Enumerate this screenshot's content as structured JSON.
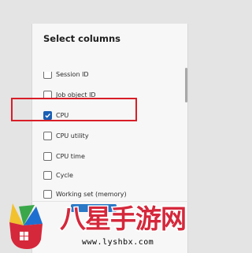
{
  "dialog": {
    "title": "Select columns",
    "columns": [
      {
        "label": "Session ID",
        "checked": false
      },
      {
        "label": "Job object ID",
        "checked": false
      },
      {
        "label": "CPU",
        "checked": true
      },
      {
        "label": "CPU utility",
        "checked": false,
        "highlighted": true
      },
      {
        "label": "CPU time",
        "checked": false
      },
      {
        "label": "Cycle",
        "checked": false
      },
      {
        "label": "Working set (memory)",
        "checked": false
      }
    ]
  },
  "watermark": {
    "brand": "八星手游网",
    "url": "www.lyshbx.com",
    "colors": {
      "text": "#d5283b",
      "yellow": "#f2c12e",
      "green": "#3aa84a",
      "blue": "#1f6fd1"
    }
  },
  "colors": {
    "accent": "#1a5fb4",
    "highlight_border": "#d81e28",
    "background": "#e4e4e4",
    "dialog": "#f7f7f7"
  }
}
